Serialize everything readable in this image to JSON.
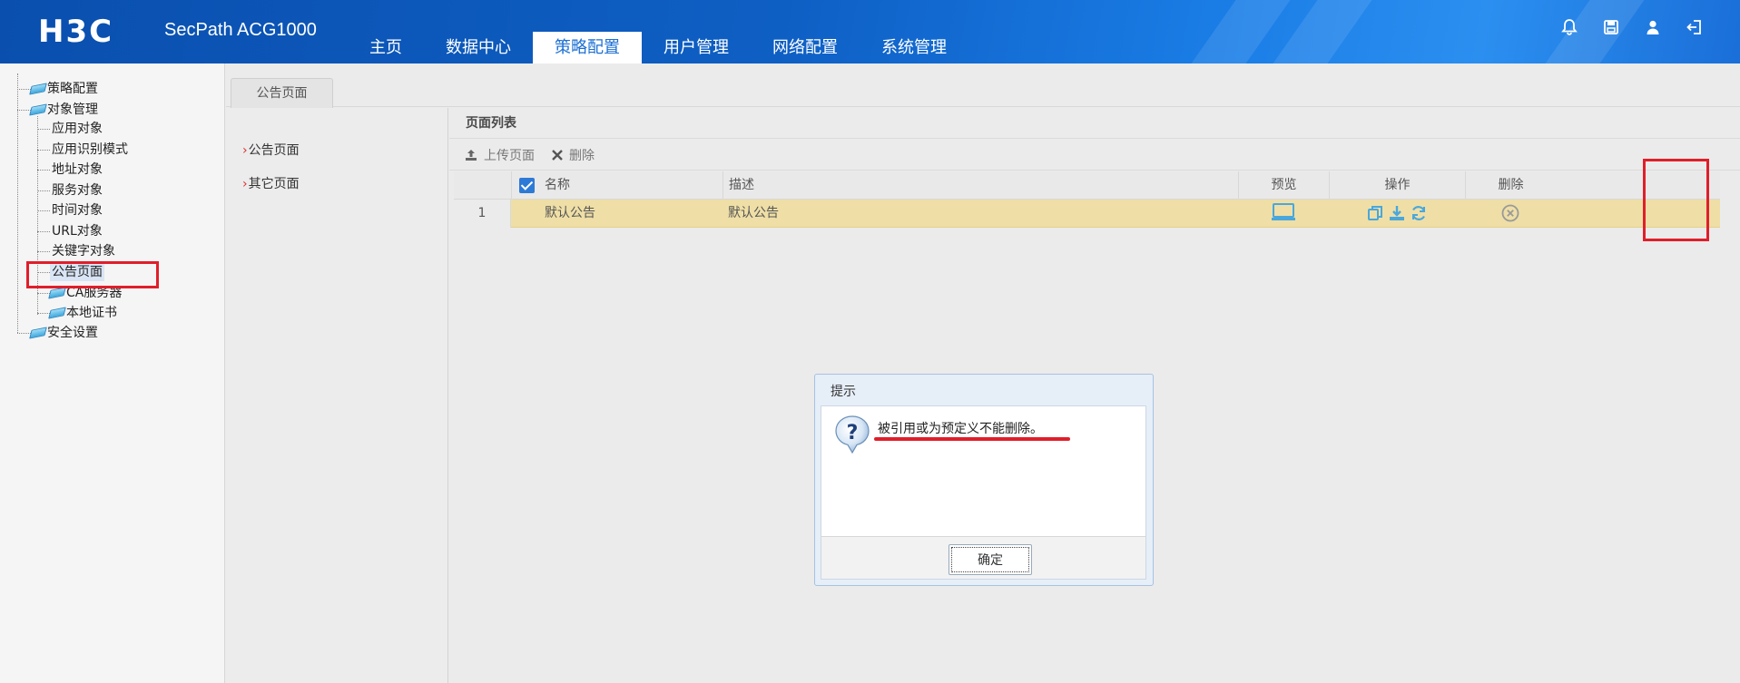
{
  "header": {
    "logo_text": "H3C",
    "product": "SecPath ACG1000",
    "nav": [
      "主页",
      "数据中心",
      "策略配置",
      "用户管理",
      "网络配置",
      "系统管理"
    ],
    "active_nav": "策略配置",
    "icons": [
      "bell-icon",
      "save-icon",
      "user-icon",
      "logout-icon"
    ]
  },
  "tree": {
    "root1": "策略配置",
    "root2": "对象管理",
    "children": [
      "应用对象",
      "应用识别模式",
      "地址对象",
      "服务对象",
      "时间对象",
      "URL对象",
      "关键字对象",
      "公告页面"
    ],
    "sub_folders": [
      "CA服务器",
      "本地证书"
    ],
    "root3": "安全设置",
    "selected": "公告页面"
  },
  "tab": {
    "label": "公告页面"
  },
  "submenu": {
    "items": [
      "公告页面",
      "其它页面"
    ]
  },
  "list": {
    "title": "页面列表",
    "toolbar": {
      "upload": "上传页面",
      "delete": "删除"
    },
    "columns": {
      "name": "名称",
      "desc": "描述",
      "preview": "预览",
      "ops": "操作",
      "del": "删除"
    },
    "rows": [
      {
        "index": "1",
        "name": "默认公告",
        "desc": "默认公告"
      }
    ]
  },
  "dialog": {
    "title": "提示",
    "message": "被引用或为预定义不能删除。",
    "ok": "确定"
  },
  "colors": {
    "header": "#0e5fc4",
    "highlight_row": "#efdfa6",
    "annotation_red": "#e01e2a",
    "accent": "#1b6fd4"
  }
}
